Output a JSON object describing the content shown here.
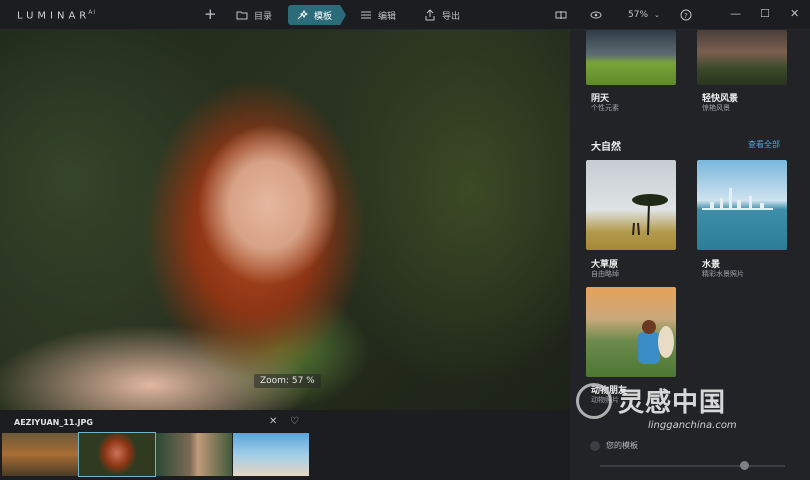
{
  "app": {
    "logo": "LUMINAR",
    "logo_suffix": "AI"
  },
  "toolbar": {
    "catalog_label": "目录",
    "templates_label": "模板",
    "edit_label": "编辑",
    "export_label": "导出",
    "zoom_value": "57%",
    "icons": [
      "plus-icon",
      "folder-icon",
      "templates-icon",
      "edit-icon",
      "export-icon",
      "compare-icon",
      "eye-icon",
      "help-icon"
    ]
  },
  "viewer": {
    "zoom_overlay": "Zoom: 57 %"
  },
  "filmstrip": {
    "filename": "AEZIYUAN_11.JPG",
    "selected_index": 1
  },
  "templates": {
    "top_row": [
      {
        "title": "阴天",
        "subtitle": "个性元素"
      },
      {
        "title": "轻快风景",
        "subtitle": "惊艳风景"
      }
    ],
    "nature": {
      "section_title": "大自然",
      "see_all": "查看全部",
      "items": [
        {
          "title": "大草原",
          "subtitle": "自由略绰"
        },
        {
          "title": "水景",
          "subtitle": "精彩水景照片"
        },
        {
          "title": "动物朋友",
          "subtitle": "动物照片"
        }
      ]
    },
    "my_templates_label": "您的模板"
  },
  "watermark": {
    "text": "灵感中国",
    "url": "lingganchina.com"
  },
  "colors": {
    "accent": "#2c6b7a",
    "link": "#4ea8df",
    "panel": "#212327",
    "topbar": "#1b1d20"
  }
}
